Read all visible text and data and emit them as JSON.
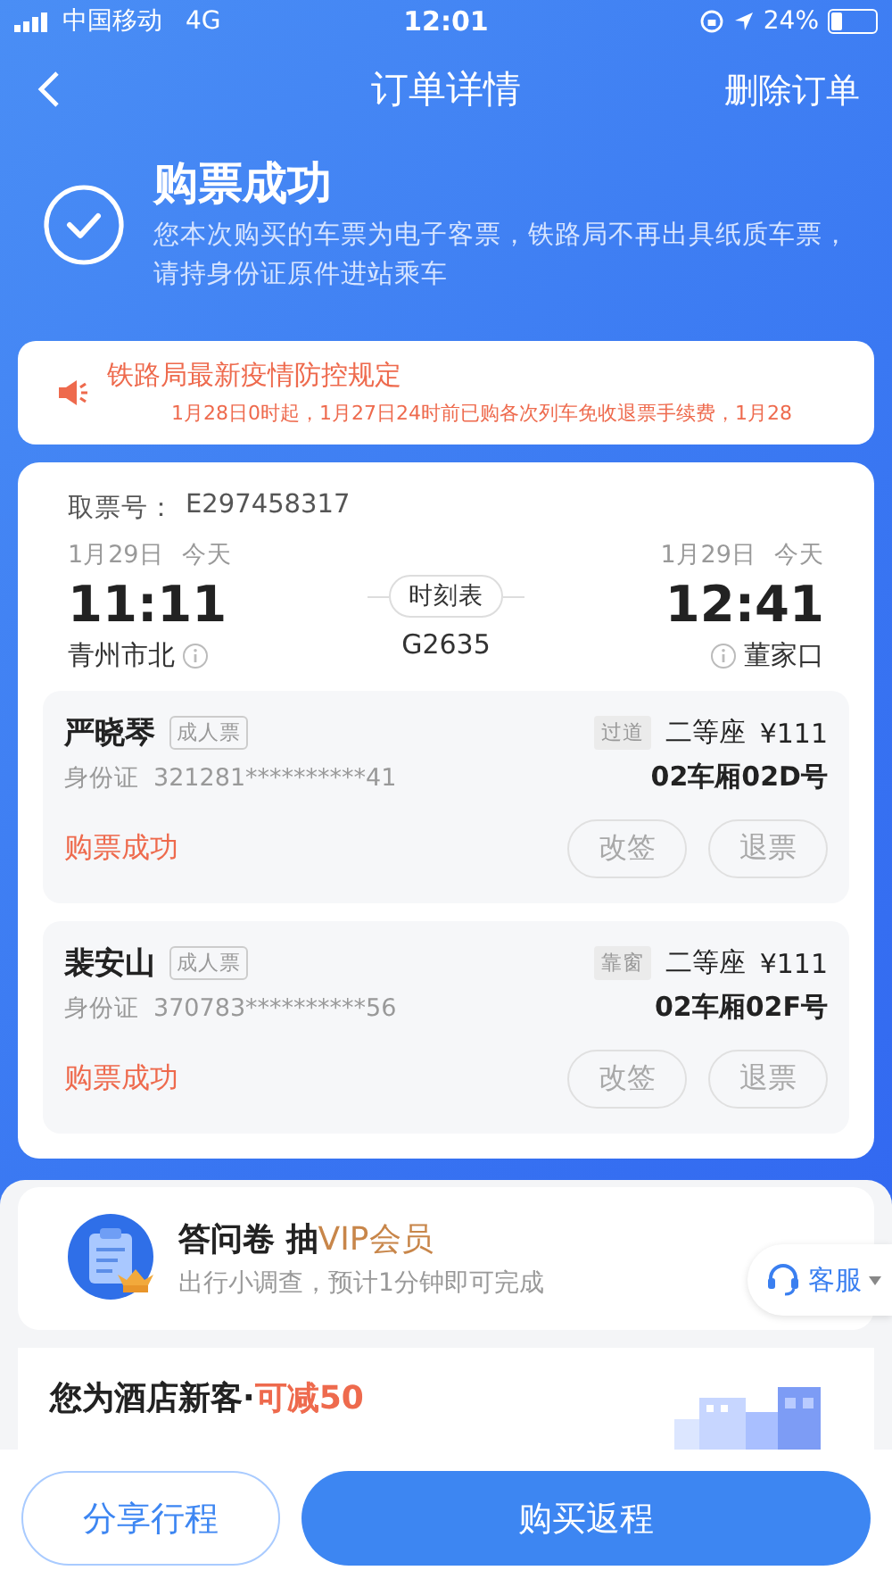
{
  "status_bar": {
    "carrier": "中国移动",
    "network": "4G",
    "time": "12:01",
    "battery": "24%"
  },
  "nav": {
    "title": "订单详情",
    "action": "删除订单"
  },
  "result": {
    "title": "购票成功",
    "desc": "您本次购买的车票为电子客票，铁路局不再出具纸质车票，请持身份证原件进站乘车"
  },
  "notice": {
    "title": "铁路局最新疫情防控规定",
    "text": "1月28日0时起，1月27日24时前已购各次列车免收退票手续费，1月28"
  },
  "ticket": {
    "pickup_label": "取票号：",
    "pickup_no": "E297458317",
    "depart": {
      "date": "1月29日",
      "day": "今天",
      "time": "11:11",
      "station": "青州市北"
    },
    "arrive": {
      "date": "1月29日",
      "day": "今天",
      "time": "12:41",
      "station": "董家口"
    },
    "timetable": "时刻表",
    "train": "G2635",
    "passengers": [
      {
        "name": "严晓琴",
        "type": "成人票",
        "id_label": "身份证",
        "id_no": "321281**********41",
        "seat_tag": "过道",
        "seat_class": "二等座",
        "price": "¥111",
        "seat": "02车厢02D号",
        "status": "购票成功",
        "actions": [
          {
            "label": "改签",
            "disabled": true
          },
          {
            "label": "退票",
            "disabled": true
          }
        ]
      },
      {
        "name": "裴安山",
        "type": "成人票",
        "id_label": "身份证",
        "id_no": "370783**********56",
        "seat_tag": "靠窗",
        "seat_class": "二等座",
        "price": "¥111",
        "seat": "02车厢02F号",
        "status": "购票成功",
        "actions": [
          {
            "label": "改签",
            "disabled": true
          },
          {
            "label": "退票",
            "disabled": true
          }
        ]
      }
    ]
  },
  "survey": {
    "title": "答问卷 抽",
    "title_highlight": "VIP会员",
    "subtitle": "出行小调查，预计1分钟即可完成"
  },
  "service": {
    "label": "客服"
  },
  "hotel": {
    "title": "您为酒店新客·",
    "highlight": "可减50"
  },
  "buttons": [
    {
      "label": "分享行程",
      "kind": "outline"
    },
    {
      "label": "购买返程",
      "kind": "primary"
    }
  ]
}
